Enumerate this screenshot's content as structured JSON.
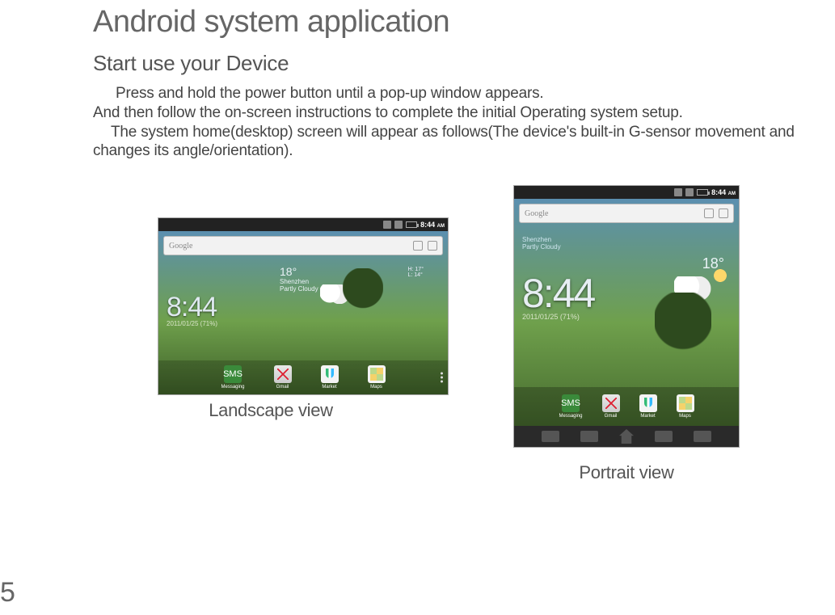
{
  "page_number": "5",
  "title": "Android system application",
  "subheading": "Start use your Device",
  "body": {
    "line1": "Press and hold the power button  until a pop-up window appears.",
    "line2": "And then follow the on-screen instructions to complete the initial Operating system setup.",
    "line3": "The system home(desktop) screen will appear as follows(The device's built-in G-sensor movement and changes its angle/orientation)."
  },
  "captions": {
    "landscape": "Landscape view",
    "portrait": "Portrait  view"
  },
  "status": {
    "time": "8:44",
    "ampm": "AM",
    "battery": "71"
  },
  "search": {
    "engine": "Google"
  },
  "clock": {
    "time": "8:44",
    "date": "2011/01/25 (71%)"
  },
  "weather": {
    "city": "Shenzhen",
    "cond": "Partly Cloudy",
    "temp": "18°",
    "hi": "H: 17°",
    "lo": "L: 14°"
  },
  "apps": {
    "messaging": "Messaging",
    "gmail": "Gmail",
    "market": "Market",
    "maps": "Maps"
  }
}
